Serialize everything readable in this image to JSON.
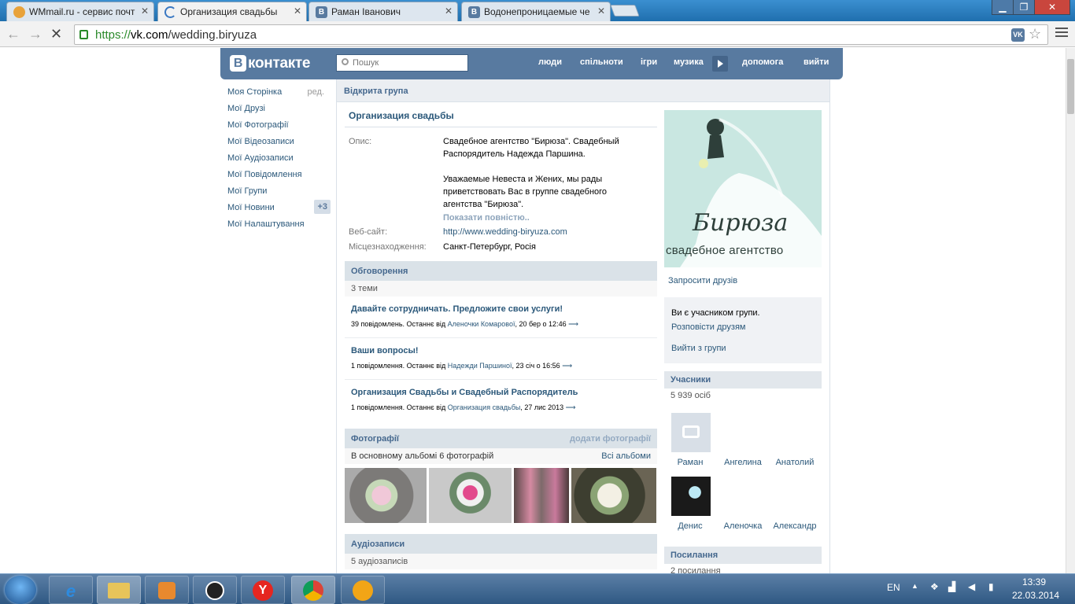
{
  "browser": {
    "tabs": [
      {
        "title": "WMmail.ru - сервис почт",
        "icon": "wmmail-icon"
      },
      {
        "title": "Организация свадьбы",
        "icon": "loading-spinner-icon"
      },
      {
        "title": "Раман Іванович",
        "icon": "vk-icon"
      },
      {
        "title": "Водонепроницаемые че",
        "icon": "vk-icon"
      }
    ],
    "url_scheme": "https://",
    "url_host": "vk.com",
    "url_path": "/wedding.biryuza"
  },
  "vk": {
    "logo": "контакте",
    "logo_b": "В",
    "search_placeholder": "Пошук",
    "nav": [
      "люди",
      "спільноти",
      "ігри",
      "музика",
      "допомога",
      "вийти"
    ]
  },
  "left_menu": {
    "items": [
      "Моя Сторінка",
      "Мої Друзі",
      "Мої Фотографії",
      "Мої Відеозаписи",
      "Мої Аудіозаписи",
      "Мої Повідомлення",
      "Мої Групи",
      "Мої Новини",
      "Мої Налаштування"
    ],
    "edit": "ред.",
    "news_badge": "+3"
  },
  "group": {
    "type": "Відкрита група",
    "name": "Организация свадьбы",
    "desc_label": "Опис:",
    "desc_p1": "Свадебное агентство \"Бирюза\". Свадебный Распорядитель Надежда Паршина.",
    "desc_p2": "Уважаемые Невеста и Жених, мы рады приветствовать Вас в группе свадебного агентства \"Бирюза\".",
    "show_more": "Показати повністю..",
    "site_label": "Веб-сайт:",
    "site": "http://www.wedding-biryuza.com",
    "location_label": "Місцезнаходження:",
    "location": "Санкт-Петербург, Росія"
  },
  "discussions": {
    "title": "Обговорення",
    "count": "3 теми",
    "topics": [
      {
        "title": "Давайте сотрудничать. Предложите свои услуги!",
        "meta": "39 повідомлень. Останнє від ",
        "author": "Аленочки Комарової",
        "date": ", 20 бер о 12:46"
      },
      {
        "title": "Ваши вопросы!",
        "meta": "1 повідомлення. Останнє від ",
        "author": "Надежди Паршиної",
        "date": ", 23 січ о 16:56"
      },
      {
        "title": "Организация Свадьбы и Свадебный Распорядитель",
        "meta": "1 повідомлення. Останнє від ",
        "author": "Организация свадьбы",
        "date": ", 27 лис 2013"
      }
    ]
  },
  "photos": {
    "title": "Фотографії",
    "add": "додати фотографії",
    "sub": "В основному альбомі 6 фотографій",
    "all": "Всі альбоми"
  },
  "audio": {
    "title": "Аудіозаписи",
    "count": "5 аудіозаписів"
  },
  "sidebar": {
    "logo_script": "Бирюза",
    "logo_sub": "свадебное агентство",
    "invite": "Запросити друзів",
    "member_status": "Ви є учасником групи.",
    "tell_friends": "Розповісти друзям",
    "leave": "Вийти з групи",
    "members_title": "Учасники",
    "members_count": "5 939 осіб",
    "members": [
      "Раман",
      "Ангелина",
      "Анатолий",
      "Денис",
      "Аленочка",
      "Александр"
    ],
    "links_title": "Посилання",
    "links_count": "2 посилання"
  },
  "taskbar": {
    "lang": "EN",
    "time": "13:39",
    "date": "22.03.2014"
  },
  "colors": {
    "vk_blue": "#587aa0",
    "link": "#2b587a",
    "accent_mint": "#c9e7e1"
  }
}
